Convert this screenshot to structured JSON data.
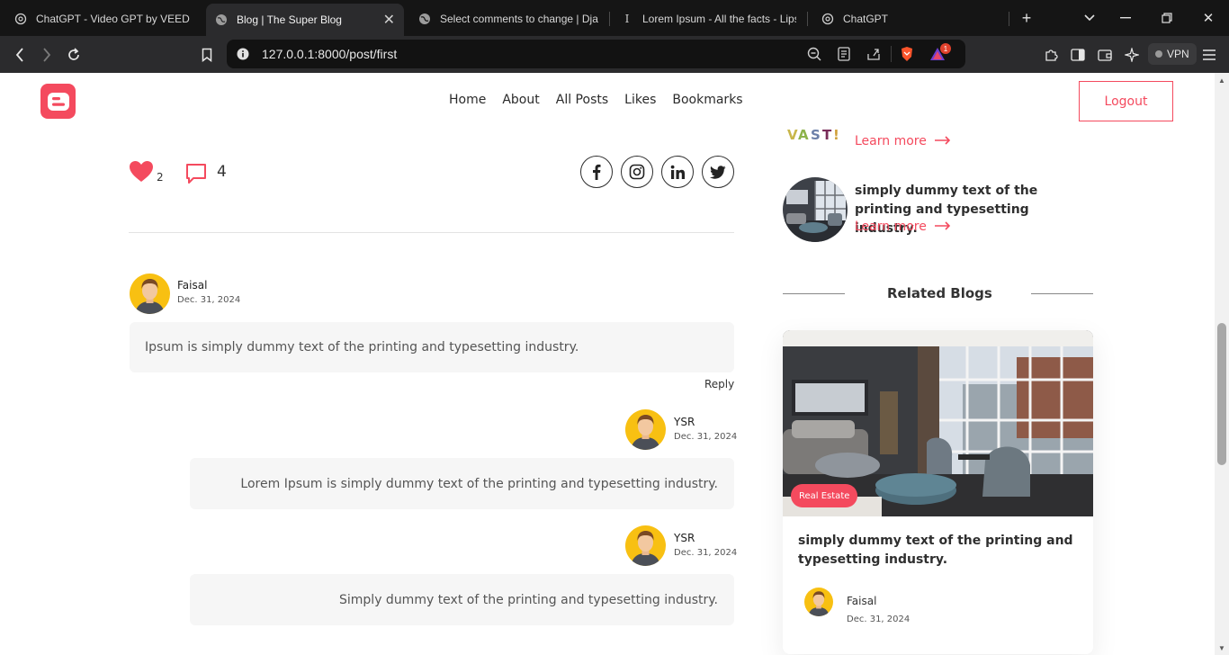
{
  "browser": {
    "tabs": [
      {
        "title": "ChatGPT - Video GPT by VEED",
        "icon": "openai-icon"
      },
      {
        "title": "Blog | The Super Blog",
        "icon": "globe-icon",
        "active": true
      },
      {
        "title": "Select comments to change | Dja",
        "icon": "globe-icon"
      },
      {
        "title": "Lorem Ipsum - All the facts - Lips",
        "icon": "lipsum-icon"
      },
      {
        "title": "ChatGPT",
        "icon": "openai-icon"
      }
    ],
    "url": "127.0.0.1:8000/post/first",
    "vpn_label": "VPN",
    "brave_badge": "1"
  },
  "header": {
    "nav": [
      "Home",
      "About",
      "All Posts",
      "Likes",
      "Bookmarks"
    ],
    "logout_label": "Logout",
    "accent_color": "#f44a5e"
  },
  "post": {
    "like_count": "2",
    "comment_count": "4",
    "social": [
      "facebook-icon",
      "instagram-icon",
      "linkedin-icon",
      "twitter-icon"
    ]
  },
  "comments": [
    {
      "author": "Faisal",
      "date": "Dec. 31, 2024",
      "text": "Ipsum is simply dummy text of the printing and typesetting industry.",
      "reply_label": "Reply"
    },
    {
      "author": "YSR",
      "date": "Dec. 31, 2024",
      "text": "Lorem Ipsum is simply dummy text of the printing and typesetting industry."
    },
    {
      "author": "YSR",
      "date": "Dec. 31, 2024",
      "text": "Simply dummy text of the printing and typesetting industry."
    }
  ],
  "sidebar": {
    "recent": [
      {
        "title": "",
        "learn_more": "Learn more"
      },
      {
        "title": "simply dummy text of the printing and typesetting industry.",
        "learn_more": "Learn more"
      }
    ],
    "related_heading": "Related Blogs",
    "related_card": {
      "badge": "Real Estate",
      "title": "simply dummy text of the printing and typesetting industry.",
      "author": "Faisal",
      "date": "Dec. 31, 2024"
    }
  }
}
